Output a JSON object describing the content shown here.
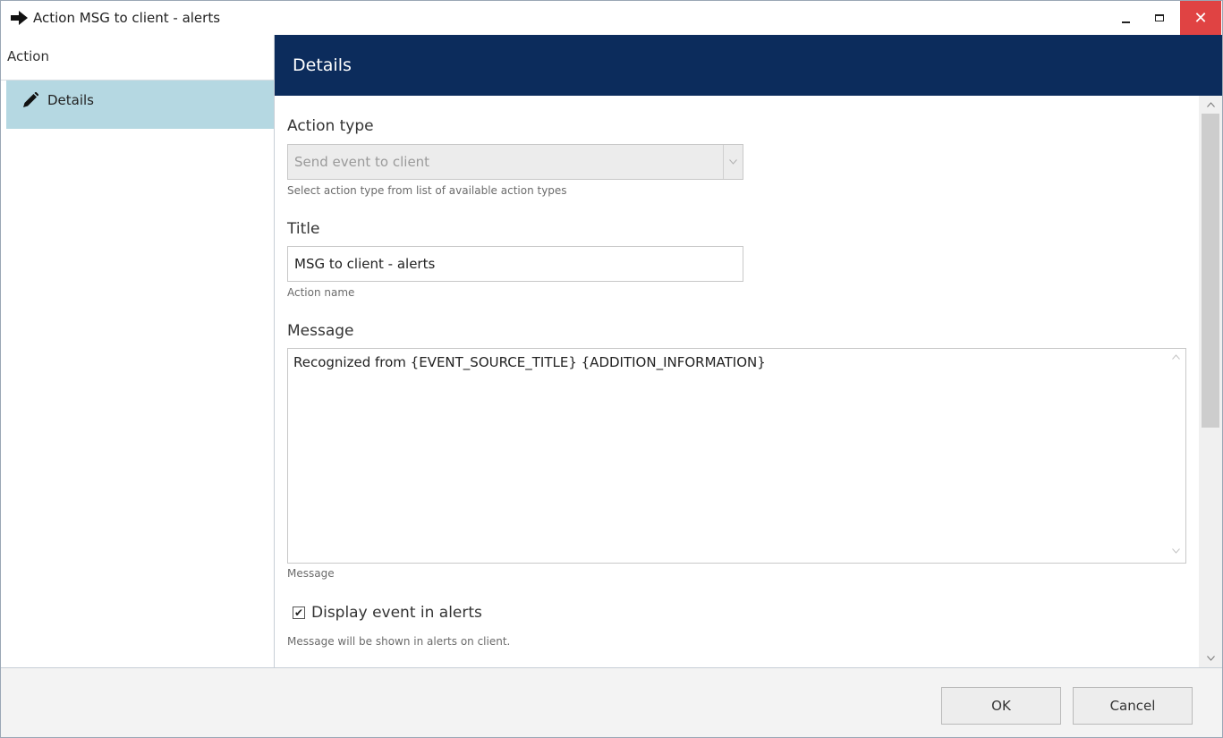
{
  "window": {
    "title": "Action MSG to client - alerts",
    "close_glyph": "✕"
  },
  "sidebar": {
    "header": "Action",
    "items": [
      {
        "label": "Details",
        "icon": "pencil-icon",
        "selected": true
      }
    ]
  },
  "content": {
    "header_title": "Details",
    "action_type": {
      "label": "Action type",
      "value": "Send event to client",
      "hint": "Select action type from list of available action types",
      "disabled": true
    },
    "title_field": {
      "label": "Title",
      "value": "MSG to client - alerts",
      "hint": "Action name"
    },
    "message_field": {
      "label": "Message",
      "value": "Recognized from {EVENT_SOURCE_TITLE} {ADDITION_INFORMATION}",
      "hint": "Message"
    },
    "display_in_alerts": {
      "label": "Display event in alerts",
      "checked": true,
      "check_glyph": "✔",
      "hint": "Message will be shown in alerts on client."
    }
  },
  "footer": {
    "ok_label": "OK",
    "cancel_label": "Cancel"
  },
  "colors": {
    "header_bg": "#0c2c5c",
    "nav_selected_bg": "#b5d8e2",
    "close_bg": "#e04343"
  }
}
